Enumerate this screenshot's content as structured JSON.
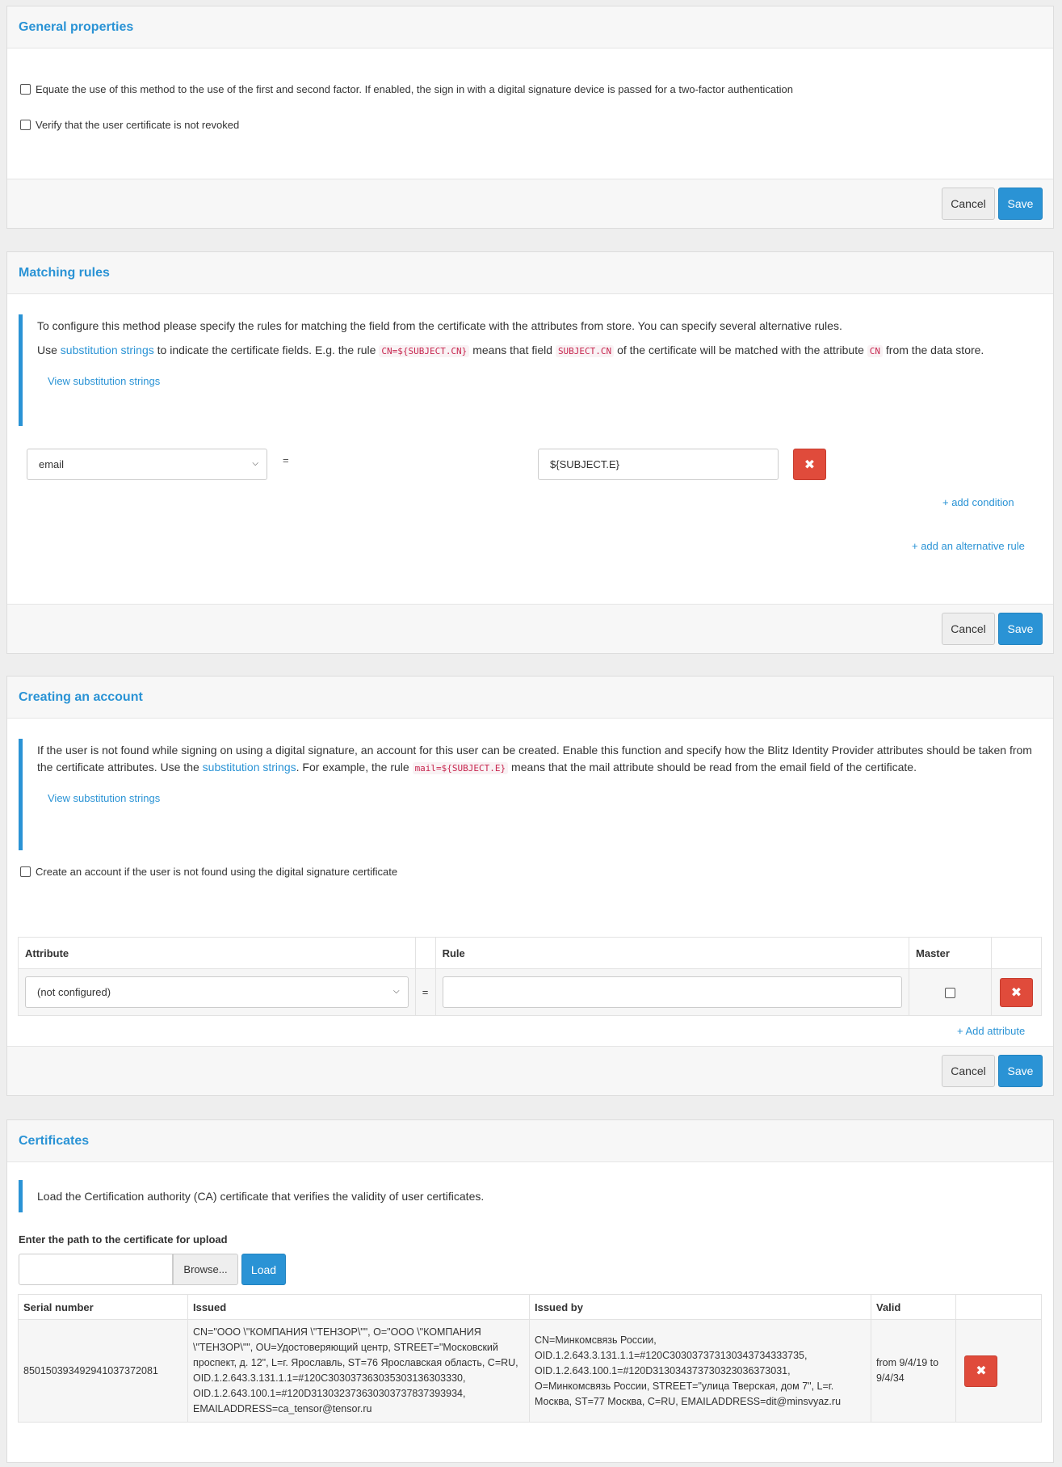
{
  "general": {
    "title": "General properties",
    "checkbox1_label": "Equate the use of this method to the use of the first and second factor. If enabled, the sign in with a digital signature device is passed for a two-factor authentication",
    "checkbox2_label": "Verify that the user certificate is not revoked",
    "cancel_label": "Cancel",
    "save_label": "Save"
  },
  "matching": {
    "title": "Matching rules",
    "info_line1": "To configure this method please specify the rules for matching the field from the certificate with the attributes from store. You can specify several alternative rules.",
    "use": "Use",
    "substitution_link": "substitution strings",
    "info_mid1": "to indicate the certificate fields. E.g. the rule",
    "code1": "CN=${SUBJECT.CN}",
    "info_mid2": "means that field",
    "code2": "SUBJECT.CN",
    "info_mid3": "of the certificate will be matched with the attribute",
    "code3": "CN",
    "info_end": "from the data store.",
    "view_link": "View substitution strings",
    "attribute_value": "email",
    "equals": "=",
    "rule_value": "${SUBJECT.E}",
    "add_condition": "+ add condition",
    "add_alternative": "+ add an alternative rule",
    "cancel_label": "Cancel",
    "save_label": "Save"
  },
  "creating": {
    "title": "Creating an account",
    "info_part1": "If the user is not found while signing on using a digital signature, an account for this user can be created. Enable this function and specify how the Blitz Identity Provider attributes should be taken from the certificate attributes. Use the",
    "substitution_link": "substitution strings",
    "info_part2": ". For example, the rule",
    "code": "mail=${SUBJECT.E}",
    "info_part3": "means that the mail attribute should be read from the email field of the certificate.",
    "view_link": "View substitution strings",
    "checkbox_label": "Create an account if the user is not found using the digital signature certificate",
    "col_attribute": "Attribute",
    "col_rule": "Rule",
    "col_master": "Master",
    "row_attribute": "(not configured)",
    "equals": "=",
    "add_attribute": "+ Add attribute",
    "cancel_label": "Cancel",
    "save_label": "Save"
  },
  "certificates": {
    "title": "Certificates",
    "info": "Load the Certification authority (CA) certificate that verifies the validity of user certificates.",
    "path_label": "Enter the path to the certificate for upload",
    "browse_label": "Browse...",
    "load_label": "Load",
    "col_serial": "Serial number",
    "col_issued": "Issued",
    "col_issued_by": "Issued by",
    "col_valid": "Valid",
    "row": {
      "serial": "850150393492941037372081",
      "issued": "CN=\"ООО \\\"КОМПАНИЯ \\\"ТЕНЗОР\\\"\", O=\"ООО \\\"КОМПАНИЯ \\\"ТЕНЗОР\\\"\", OU=Удостоверяющий центр, STREET=\"Московский проспект, д. 12\", L=г. Ярославль, ST=76 Ярославская область, C=RU, OID.1.2.643.3.131.1.1=#120C303037363035303136303330, OID.1.2.643.100.1=#120D313032373630303737837393934, EMAILADDRESS=ca_tensor@tensor.ru",
      "issued_by": "CN=Минкомсвязь России, OID.1.2.643.3.131.1.1=#120C303037373130343734333735, OID.1.2.643.100.1=#120D313034373730323036373031, O=Минкомсвязь России, STREET=\"улица Тверская, дом 7\", L=г. Москва, ST=77 Москва, C=RU, EMAILADDRESS=dit@minsvyaz.ru",
      "valid": "from 9/4/19 to 9/4/34"
    }
  },
  "icons": {
    "delete": "times-icon",
    "dropdown": "chevron-down-icon",
    "checkbox": "checkbox-icon"
  },
  "colors": {
    "accent": "#2a93d5",
    "danger": "#e04b3b"
  }
}
